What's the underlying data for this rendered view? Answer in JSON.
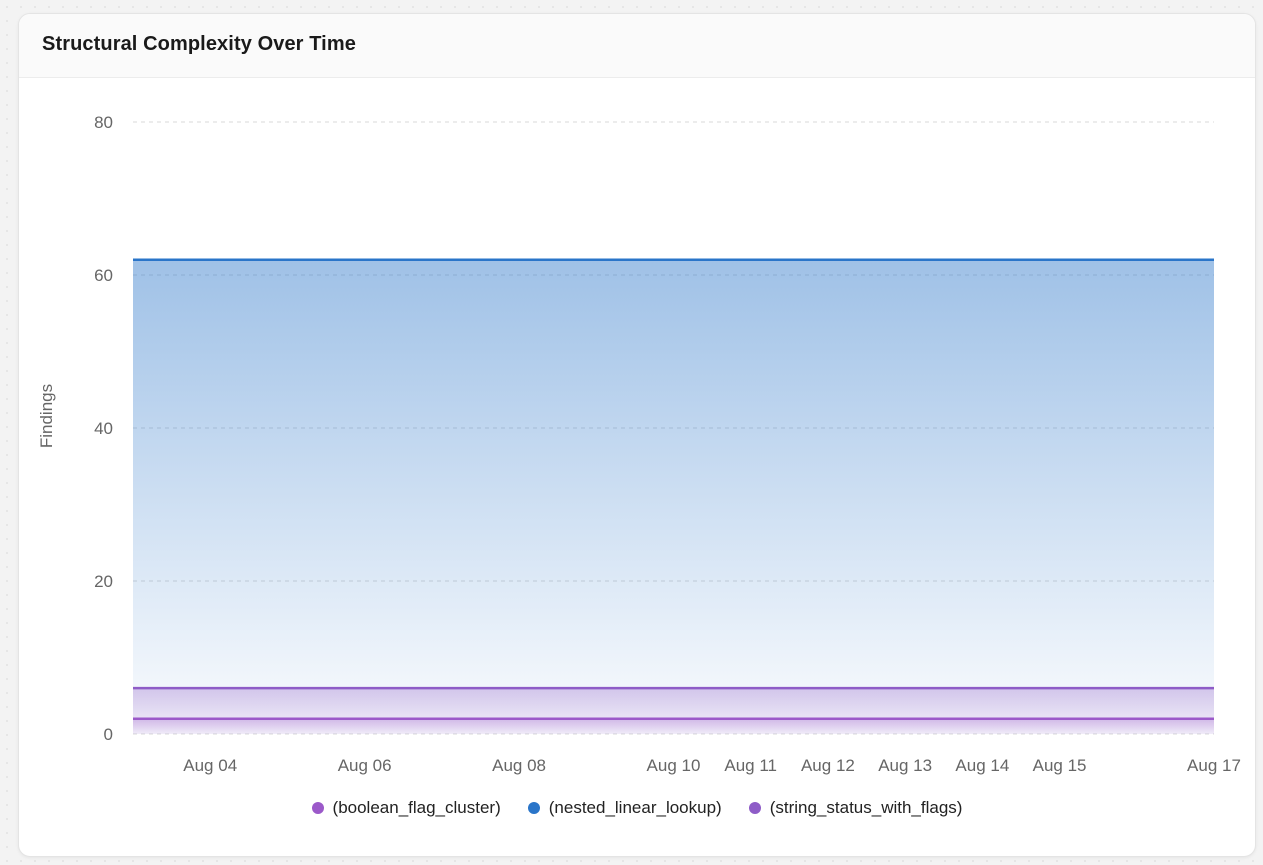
{
  "card": {
    "title": "Structural Complexity Over Time"
  },
  "chart_data": {
    "type": "area",
    "title": "Structural Complexity Over Time",
    "xlabel": "",
    "ylabel": "Findings",
    "ylim": [
      0,
      80
    ],
    "yticks": [
      0,
      20,
      40,
      60,
      80
    ],
    "grid": true,
    "legend_position": "bottom",
    "x": [
      "2024-08-03",
      "2024-08-17"
    ],
    "xticks": [
      {
        "date": "2024-08-04",
        "label": "Aug 04"
      },
      {
        "date": "2024-08-06",
        "label": "Aug 06"
      },
      {
        "date": "2024-08-08",
        "label": "Aug 08"
      },
      {
        "date": "2024-08-10",
        "label": "Aug 10"
      },
      {
        "date": "2024-08-11",
        "label": "Aug 11"
      },
      {
        "date": "2024-08-12",
        "label": "Aug 12"
      },
      {
        "date": "2024-08-13",
        "label": "Aug 13"
      },
      {
        "date": "2024-08-14",
        "label": "Aug 14"
      },
      {
        "date": "2024-08-15",
        "label": "Aug 15"
      },
      {
        "date": "2024-08-17",
        "label": "Aug 17"
      }
    ],
    "series": [
      {
        "name": "(boolean_flag_cluster)",
        "color": "#9b59c9",
        "values": [
          2,
          2
        ]
      },
      {
        "name": "(nested_linear_lookup)",
        "color": "#2a75c9",
        "values": [
          62,
          62
        ]
      },
      {
        "name": "(string_status_with_flags)",
        "color": "#8e5cc7",
        "values": [
          6,
          6
        ]
      }
    ]
  }
}
